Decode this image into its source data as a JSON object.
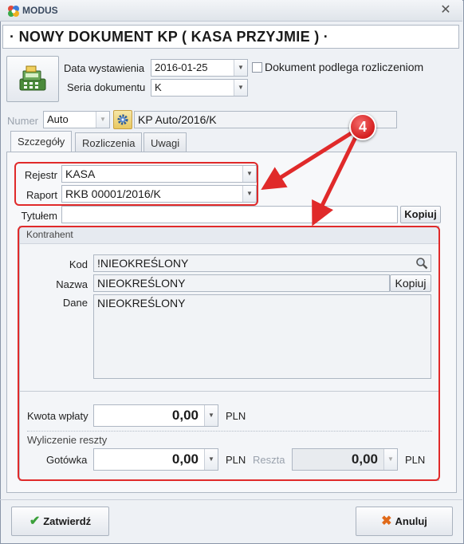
{
  "window": {
    "app_title": "MODUS",
    "close_glyph": "✕"
  },
  "document_header": "· NOWY DOKUMENT KP ( KASA PRZYJMIE ) ·",
  "form": {
    "issue_date_label": "Data wystawienia",
    "issue_date_value": "2016-01-25",
    "series_label": "Seria dokumentu",
    "series_value": "K",
    "settlement_checkbox_label": "Dokument podlega rozliczeniom",
    "number_label": "Numer",
    "number_mode": "Auto",
    "number_value": "KP Auto/2016/K"
  },
  "tabs": [
    {
      "label": "Szczegóły",
      "active": true
    },
    {
      "label": "Rozliczenia",
      "active": false
    },
    {
      "label": "Uwagi",
      "active": false
    }
  ],
  "details": {
    "register_label": "Rejestr",
    "register_value": "KASA",
    "report_label": "Raport",
    "report_value": "RKB 00001/2016/K",
    "title_label": "Tytułem",
    "title_value": "",
    "copy_label": "Kopiuj"
  },
  "contractor": {
    "group_title": "Kontrahent",
    "code_label": "Kod",
    "code_value": "!NIEOKREŚLONY",
    "name_label": "Nazwa",
    "name_value": "NIEOKREŚLONY",
    "name_copy_label": "Kopiuj",
    "data_label": "Dane",
    "data_value": "NIEOKREŚLONY"
  },
  "payment": {
    "amount_label": "Kwota wpłaty",
    "amount_value": "0,00",
    "currency": "PLN",
    "change_section_label": "Wyliczenie reszty",
    "cash_label": "Gotówka",
    "cash_value": "0,00",
    "cash_currency": "PLN",
    "change_label": "Reszta",
    "change_value": "0,00",
    "change_currency": "PLN"
  },
  "annotation": {
    "badge_number": "4",
    "color": "#e02a2a"
  },
  "buttons": {
    "confirm_label": "Zatwierdź",
    "cancel_label": "Anuluj"
  }
}
